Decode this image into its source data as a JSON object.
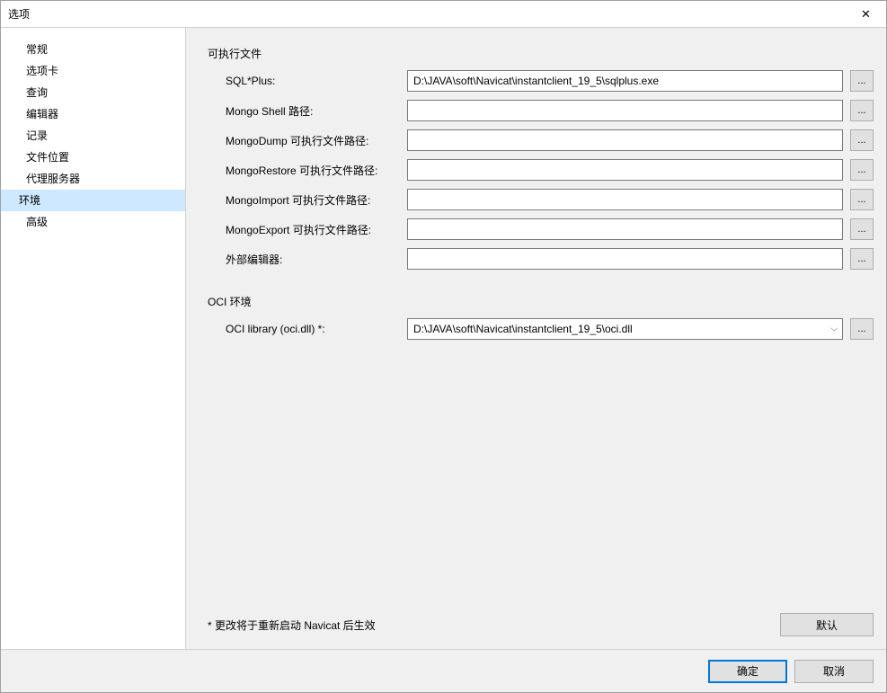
{
  "window": {
    "title": "选项"
  },
  "sidebar": {
    "items": [
      {
        "label": "常规"
      },
      {
        "label": "选项卡"
      },
      {
        "label": "查询"
      },
      {
        "label": "编辑器"
      },
      {
        "label": "记录"
      },
      {
        "label": "文件位置"
      },
      {
        "label": "代理服务器"
      },
      {
        "label": "环境",
        "selected": true
      },
      {
        "label": "高级"
      }
    ]
  },
  "sections": {
    "executables": {
      "title": "可执行文件",
      "fields": {
        "sqlplus": {
          "label": "SQL*Plus:",
          "value": "D:\\JAVA\\soft\\Navicat\\instantclient_19_5\\sqlplus.exe"
        },
        "mongoShell": {
          "label": "Mongo Shell 路径:",
          "value": ""
        },
        "mongoDump": {
          "label": "MongoDump 可执行文件路径:",
          "value": ""
        },
        "mongoRestore": {
          "label": "MongoRestore 可执行文件路径:",
          "value": ""
        },
        "mongoImport": {
          "label": "MongoImport 可执行文件路径:",
          "value": ""
        },
        "mongoExport": {
          "label": "MongoExport 可执行文件路径:",
          "value": ""
        },
        "externalEditor": {
          "label": "外部编辑器:",
          "value": ""
        }
      }
    },
    "oci": {
      "title": "OCI 环境",
      "fields": {
        "ociLibrary": {
          "label": "OCI library (oci.dll) *:",
          "value": "D:\\JAVA\\soft\\Navicat\\instantclient_19_5\\oci.dll"
        }
      }
    }
  },
  "notice": "* 更改将于重新启动 Navicat 后生效",
  "buttons": {
    "browse": "...",
    "default": "默认",
    "ok": "确定",
    "cancel": "取消"
  }
}
